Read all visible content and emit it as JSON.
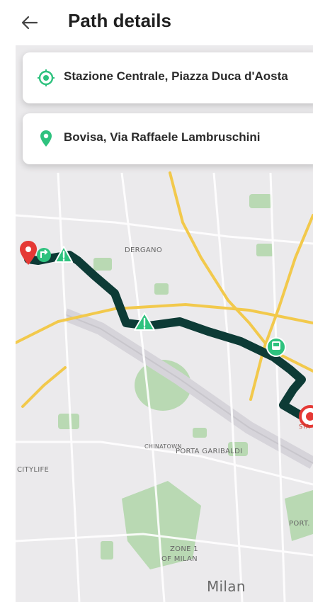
{
  "header": {
    "title": "Path details",
    "back_icon": "arrow-left-icon"
  },
  "route": {
    "from": {
      "label": "Stazione Centrale, Piazza Duca d'Aosta",
      "icon": "origin-target-icon"
    },
    "to": {
      "label": "Bovisa, Via Raffaele Lambruschini",
      "icon": "destination-pin-icon"
    }
  },
  "map": {
    "labels": {
      "dergano": "DERGANO",
      "porta_garibaldi": "PORTA GARIBALDI",
      "chinatown": "CHINATOWN",
      "citylife": "CITYLIFE",
      "porta": "PORT.",
      "zone1_line1": "ZONE 1",
      "zone1_line2": "OF MILAN",
      "milan": "Milan",
      "sta": "STA"
    },
    "colors": {
      "route": "#0d3b36",
      "accent": "#2ec27e",
      "start": "#e53935",
      "park": "#b9d9b3",
      "road": "#f2c94c"
    }
  }
}
